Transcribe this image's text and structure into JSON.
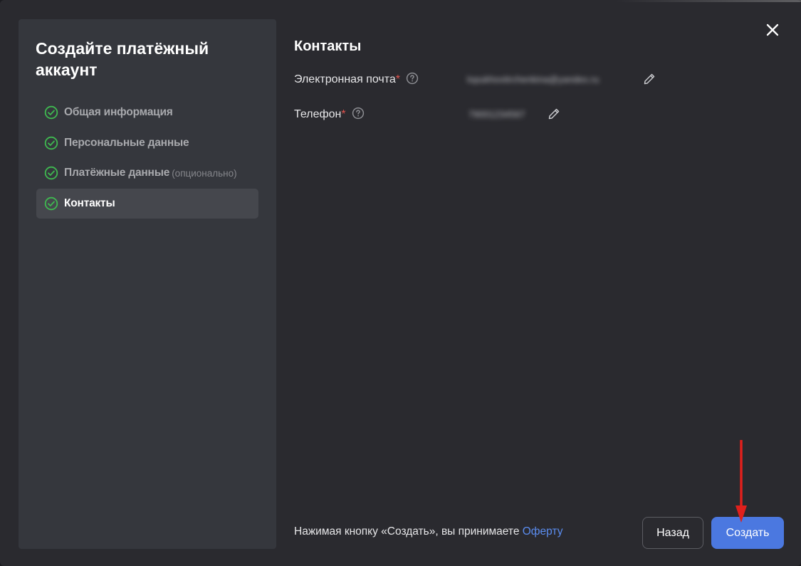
{
  "sidebar": {
    "title": "Создайте платёжный аккаунт",
    "steps": [
      {
        "label": "Общая информация",
        "optional": "",
        "completed": true,
        "active": false
      },
      {
        "label": "Персональные данные",
        "optional": "",
        "completed": true,
        "active": false
      },
      {
        "label": "Платёжные данные",
        "optional": "(опционально)",
        "completed": true,
        "active": false
      },
      {
        "label": "Контакты",
        "optional": "",
        "completed": true,
        "active": true
      }
    ]
  },
  "content": {
    "title": "Контакты",
    "fields": [
      {
        "label": "Электронная почта",
        "required_mark": "*",
        "value": "lopukhovtirchenkina@yandex.ru"
      },
      {
        "label": "Телефон",
        "required_mark": "*",
        "value": "79001234567"
      }
    ]
  },
  "footer": {
    "notice": "Нажимая кнопку «Создать», вы принимаете ",
    "offer_link": "Оферту",
    "back_button": "Назад",
    "create_button": "Создать"
  },
  "icons": {
    "step_status": "check-circle-icon",
    "help": "question-circle-icon",
    "edit": "pencil-icon",
    "close": "close-icon"
  },
  "colors": {
    "background": "#2a2a2f",
    "sidebar": "#35373d",
    "check_green": "#3fb950",
    "required_red": "#e0524d",
    "link_blue": "#5b8df0",
    "primary_button": "#4b78e0",
    "annotation_arrow": "#e0201c"
  }
}
